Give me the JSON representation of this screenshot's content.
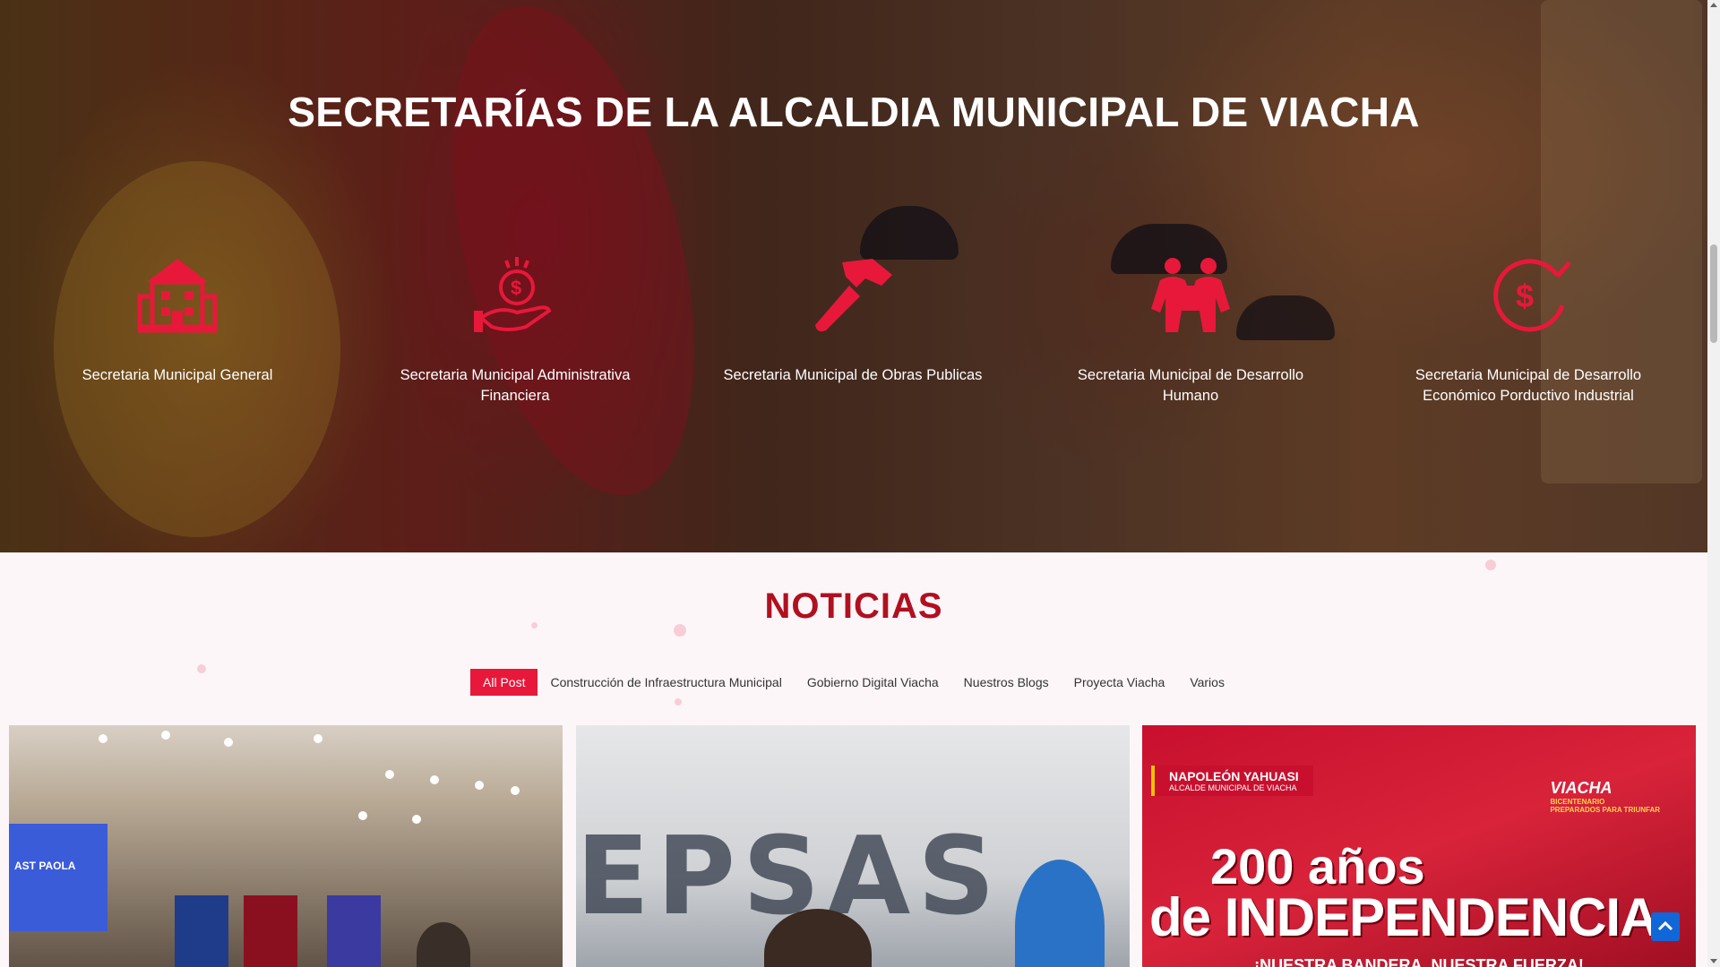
{
  "hero": {
    "title": "SECRETARÍAS DE LA ALCALDIA MUNICIPAL DE VIACHA",
    "items": [
      {
        "label": "Secretaria Municipal General",
        "icon": "town-hall-icon"
      },
      {
        "label": "Secretaria Municipal Administrativa Financiera",
        "icon": "money-hand-icon"
      },
      {
        "label": "Secretaria Municipal de Obras Publicas",
        "icon": "hammer-icon"
      },
      {
        "label": "Secretaria Municipal de Desarrollo Humano",
        "icon": "people-hug-icon"
      },
      {
        "label": "Secretaria Municipal de Desarrollo Económico Porductivo Industrial",
        "icon": "dollar-cycle-icon"
      }
    ]
  },
  "news": {
    "title": "NOTICIAS",
    "filters": [
      "All Post",
      "Construcción de Infraestructura Municipal",
      "Gobierno Digital Viacha",
      "Nuestros Blogs",
      "Proyecta Viacha",
      "Varios"
    ],
    "cards": {
      "card1": {
        "screen_text": "AST PAOLA"
      },
      "card2": {
        "sign_text": "EPSAS"
      },
      "card3": {
        "badge_name": "NAPOLEÓN YAHUASI",
        "badge_role": "ALCALDE MUNICIPAL DE VIACHA",
        "brand": "VIACHA",
        "brand_sub": "BICENTENARIO",
        "brand_tagline": "PREPARADOS PARA TRIUNFAR",
        "headline1": "200 años",
        "headline2": "de INDEPENDENCIA",
        "slogan": "¡NUESTRA BANDERA, NUESTRA FUERZA!"
      }
    }
  },
  "colors": {
    "accent": "#e8183a",
    "news_title": "#b01020",
    "icon": "#e8183a",
    "scroll_top_button": "#1167d8"
  },
  "controls": {
    "scroll_top_icon": "chevron-up-icon"
  }
}
